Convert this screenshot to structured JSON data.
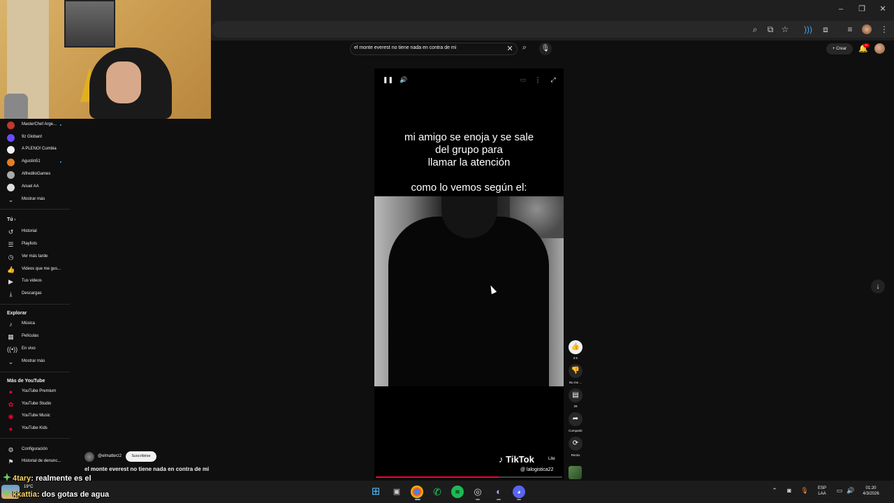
{
  "window": {
    "minimize": "–",
    "maximize": "❐",
    "close": "✕"
  },
  "toolbar_icons": [
    "zoom-icon",
    "install-icon",
    "bookmark-star-icon",
    "extension-audio-icon",
    "extensions-icon",
    "tab-search-icon",
    "profile-icon",
    "menu-icon"
  ],
  "search": {
    "query": "el monte everest no tiene nada en contra de mi",
    "clear": "✕"
  },
  "header": {
    "create_label": "Crear",
    "notification_badge": "9+"
  },
  "sidebar": {
    "subscriptions": [
      {
        "label": "MasterChef Arge...",
        "dot": true,
        "color": "#c0392b"
      },
      {
        "label": "9z Globant",
        "dot": false,
        "color": "#6a4cff"
      },
      {
        "label": "A PLENO! Cumbia",
        "dot": false,
        "color": "#f1f1f1"
      },
      {
        "label": "Agustin51",
        "dot": true,
        "color": "#e67e22"
      },
      {
        "label": "AlfreditoGames",
        "dot": false,
        "color": "#aaaaaa"
      },
      {
        "label": "Anuel AA",
        "dot": false,
        "color": "#dddddd"
      }
    ],
    "show_more_1": "Mostrar más",
    "you_heading": "Tú",
    "you_items": [
      {
        "label": "Historial",
        "icon": "history-icon"
      },
      {
        "label": "Playlists",
        "icon": "playlists-icon"
      },
      {
        "label": "Ver más tarde",
        "icon": "watch-later-icon"
      },
      {
        "label": "Videos que me gus...",
        "icon": "liked-icon"
      },
      {
        "label": "Tus videos",
        "icon": "your-videos-icon"
      },
      {
        "label": "Descargas",
        "icon": "downloads-icon"
      }
    ],
    "explore_heading": "Explorar",
    "explore_items": [
      {
        "label": "Música",
        "icon": "music-icon"
      },
      {
        "label": "Películas",
        "icon": "movies-icon"
      },
      {
        "label": "En vivo",
        "icon": "live-icon"
      }
    ],
    "show_more_2": "Mostrar más",
    "more_heading": "Más de YouTube",
    "more_items": [
      {
        "label": "YouTube Premium"
      },
      {
        "label": "YouTube Studio"
      },
      {
        "label": "YouTube Music"
      },
      {
        "label": "YouTube Kids"
      }
    ],
    "settings": "Configuración",
    "report_history": "Historial de denunc..."
  },
  "video": {
    "caption_top": [
      "mi amigo se enoja y se sale",
      "del grupo para",
      "llamar la atención"
    ],
    "caption_sub": "como lo vemos según el:",
    "tiktok_logo": "TikTok",
    "tiktok_lite": "Lite",
    "tiktok_handle": "@ lalogistica22",
    "progress": 0.66
  },
  "actions": {
    "like_count": "3 K",
    "dislike_label": "No me ...",
    "comment_count": "29",
    "share_label": "Compartir",
    "remix_label": "Remix"
  },
  "channel": {
    "name": "@elmatterz2",
    "subscribe": "Suscribirse",
    "title": "el monte everest no tiene nada en contra de mi"
  },
  "chat": [
    {
      "user": "4tary",
      "message": ": realmente es el"
    },
    {
      "user": "kkattia",
      "message": ": dos gotas de agua"
    }
  ],
  "weather": "19°C",
  "taskbar": {
    "lang_top": "ESP",
    "lang_bottom": "LAA",
    "time": "01:20",
    "date": "4/3/2026"
  }
}
